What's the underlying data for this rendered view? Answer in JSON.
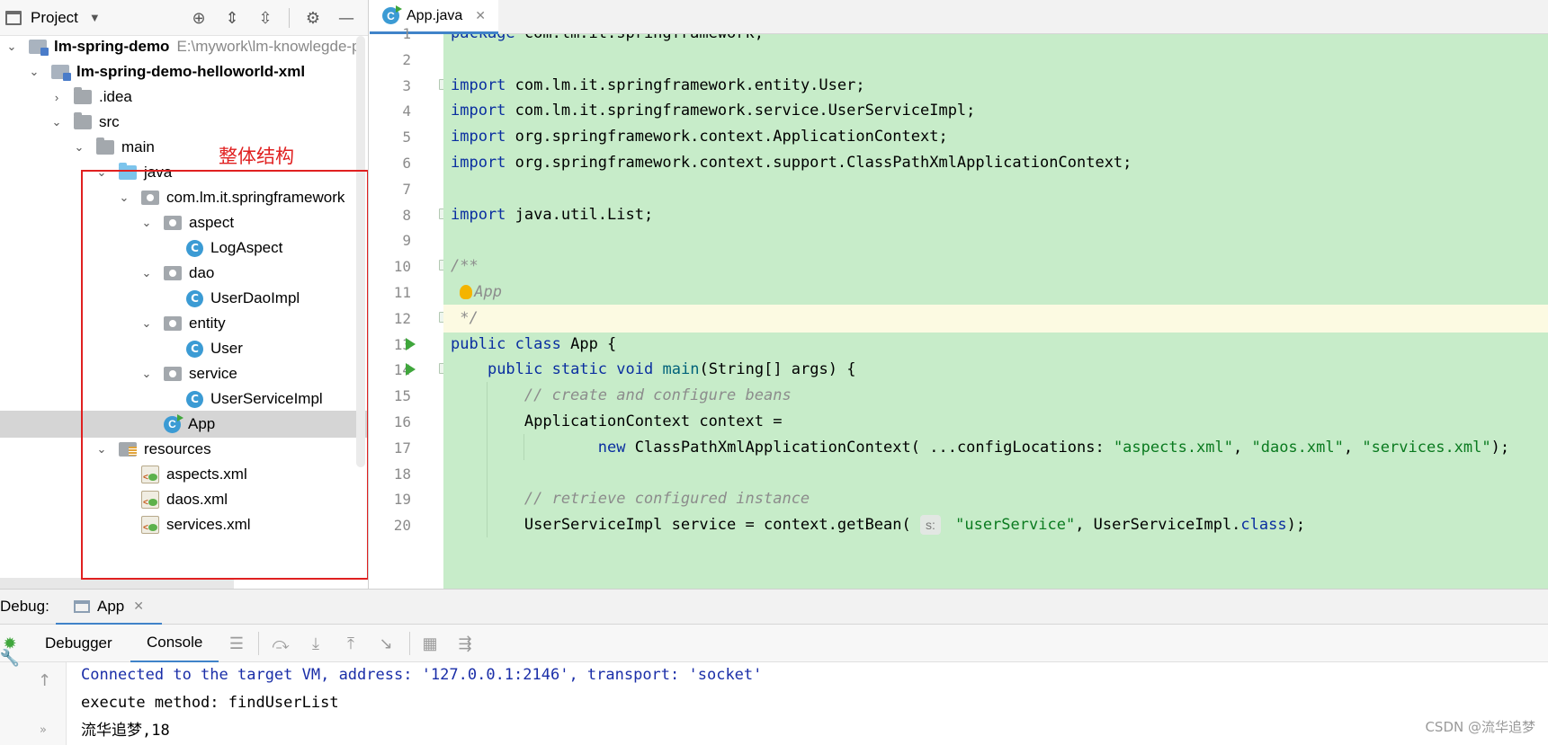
{
  "project_panel": {
    "title": "Project",
    "icons": [
      "locate-icon",
      "expand-all-icon",
      "collapse-all-icon",
      "settings-icon",
      "hide-icon"
    ]
  },
  "tree": [
    {
      "label": "lm-spring-demo",
      "extra": "E:\\mywork\\lm-knowlegde-p",
      "icon": "module",
      "expanded": true,
      "bold": true
    },
    {
      "label": "lm-spring-demo-helloworld-xml",
      "icon": "module",
      "expanded": true,
      "bold": true
    },
    {
      "label": ".idea",
      "icon": "folder",
      "expanded": false
    },
    {
      "label": "src",
      "icon": "folder",
      "expanded": true
    },
    {
      "label": "main",
      "icon": "folder",
      "expanded": true
    },
    {
      "label": "java",
      "icon": "source-folder",
      "expanded": true
    },
    {
      "label": "com.lm.it.springframework",
      "icon": "package",
      "expanded": true
    },
    {
      "label": "aspect",
      "icon": "package",
      "expanded": true
    },
    {
      "label": "LogAspect",
      "icon": "class"
    },
    {
      "label": "dao",
      "icon": "package",
      "expanded": true
    },
    {
      "label": "UserDaoImpl",
      "icon": "class"
    },
    {
      "label": "entity",
      "icon": "package",
      "expanded": true
    },
    {
      "label": "User",
      "icon": "class"
    },
    {
      "label": "service",
      "icon": "package",
      "expanded": true
    },
    {
      "label": "UserServiceImpl",
      "icon": "class"
    },
    {
      "label": "App",
      "icon": "runnable-class",
      "selected": true
    },
    {
      "label": "resources",
      "icon": "resources-folder",
      "expanded": true
    },
    {
      "label": "aspects.xml",
      "icon": "spring-xml"
    },
    {
      "label": "daos.xml",
      "icon": "spring-xml"
    },
    {
      "label": "services.xml",
      "icon": "spring-xml"
    }
  ],
  "annotation": "整体结构",
  "annotation_color": "#e02020",
  "editor": {
    "tab": "App.java",
    "current_line": 12,
    "lines": [
      {
        "n": "1",
        "code": "package com.lm.it.springframework;"
      },
      {
        "n": "2",
        "code": ""
      },
      {
        "n": "3",
        "code": "import com.lm.it.springframework.entity.User;"
      },
      {
        "n": "4",
        "code": "import com.lm.it.springframework.service.UserServiceImpl;"
      },
      {
        "n": "5",
        "code": "import org.springframework.context.ApplicationContext;"
      },
      {
        "n": "6",
        "code": "import org.springframework.context.support.ClassPathXmlApplicationContext;"
      },
      {
        "n": "7",
        "code": ""
      },
      {
        "n": "8",
        "code": "import java.util.List;"
      },
      {
        "n": "9",
        "code": ""
      },
      {
        "n": "10",
        "code": "/**"
      },
      {
        "n": "11",
        "code": " App"
      },
      {
        "n": "12",
        "code": " */"
      },
      {
        "n": "13",
        "code": "public class App {"
      },
      {
        "n": "14",
        "code": "    public static void main(String[] args) {"
      },
      {
        "n": "15",
        "code": "        // create and configure beans"
      },
      {
        "n": "16",
        "code": "        ApplicationContext context ="
      },
      {
        "n": "17",
        "code": "                new ClassPathXmlApplicationContext( ...configLocations: \"aspects.xml\", \"daos.xml\", \"services.xml\");"
      },
      {
        "n": "18",
        "code": ""
      },
      {
        "n": "19",
        "code": "        // retrieve configured instance"
      },
      {
        "n": "20",
        "code": "        UserServiceImpl service = context.getBean( s: \"userService\", UserServiceImpl.class);"
      }
    ],
    "hint_config": "...configLocations:",
    "hint_s": "s:"
  },
  "debug": {
    "label": "Debug:",
    "tab": "App",
    "toolbar_tabs": [
      "Debugger",
      "Console"
    ],
    "active_tab": "Console"
  },
  "console": {
    "lines": [
      "Connected to the target VM, address: '127.0.0.1:2146', transport: 'socket'",
      "execute method: findUserList",
      "流华追梦,18"
    ]
  },
  "watermark": "CSDN @流华追梦"
}
